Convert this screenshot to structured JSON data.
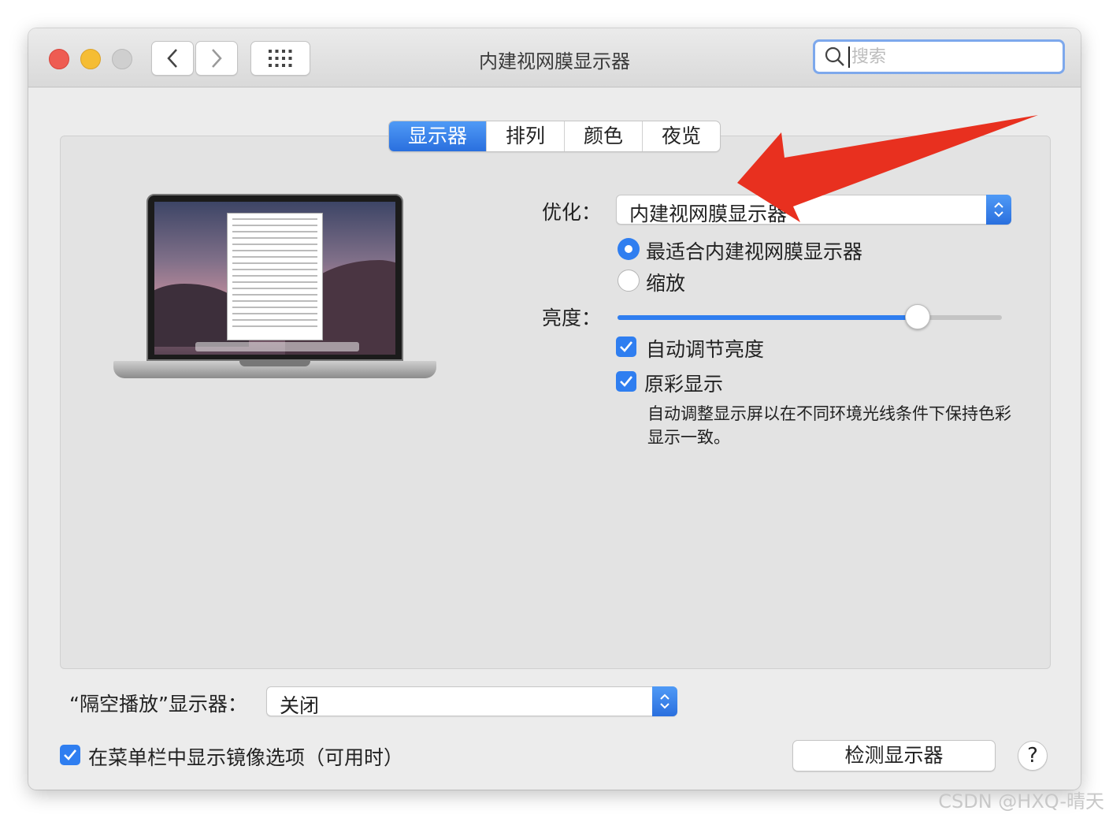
{
  "window": {
    "title": "内建视网膜显示器",
    "search_placeholder": "搜索"
  },
  "tabs": [
    {
      "label": "显示器",
      "active": true
    },
    {
      "label": "排列",
      "active": false
    },
    {
      "label": "颜色",
      "active": false
    },
    {
      "label": "夜览",
      "active": false
    }
  ],
  "display": {
    "optimize_label": "优化：",
    "optimize_value": "内建视网膜显示器",
    "resolution_options": [
      {
        "label": "最适合内建视网膜显示器",
        "selected": true
      },
      {
        "label": "缩放",
        "selected": false
      }
    ],
    "brightness_label": "亮度：",
    "brightness_level": 0.78,
    "auto_brightness": {
      "label": "自动调节亮度",
      "checked": true
    },
    "true_tone": {
      "label": "原彩显示",
      "checked": true,
      "description": "自动调整显示屏以在不同环境光线条件下保持色彩显示一致。"
    }
  },
  "airplay": {
    "label": "“隔空播放”显示器：",
    "value": "关闭"
  },
  "mirroring": {
    "label": "在菜单栏中显示镜像选项（可用时）",
    "checked": true
  },
  "buttons": {
    "detect": "检测显示器",
    "help": "?"
  },
  "watermark": "CSDN @HXQ-晴天",
  "colors": {
    "accent": "#2f7ef0",
    "annotation_arrow": "#e8301f"
  },
  "icons": [
    "close-icon",
    "minimize-icon",
    "zoom-icon",
    "chevron-left-icon",
    "chevron-right-icon",
    "grid-icon",
    "search-icon",
    "checkmark-icon",
    "updown-chevron-icon",
    "annotation-arrow"
  ]
}
